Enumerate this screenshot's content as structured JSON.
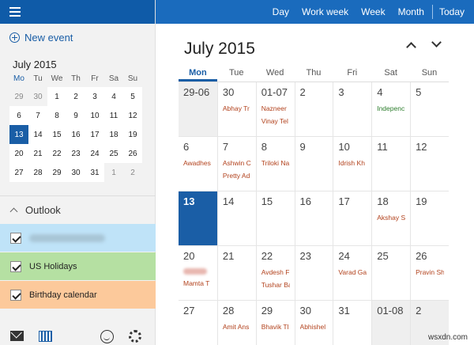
{
  "colors": {
    "accent": "#1a5ea6",
    "topbar": "#1a6bbd",
    "event_text": "#b2421d",
    "holiday_text": "#2c7d2c"
  },
  "sidebar": {
    "new_event": "New event",
    "mini_calendar": {
      "title": "July 2015",
      "days_of_week": [
        "Mo",
        "Tu",
        "We",
        "Th",
        "Fr",
        "Sa",
        "Su"
      ],
      "days": [
        {
          "d": "29",
          "out": true
        },
        {
          "d": "30",
          "out": true
        },
        {
          "d": "1"
        },
        {
          "d": "2"
        },
        {
          "d": "3"
        },
        {
          "d": "4"
        },
        {
          "d": "5"
        },
        {
          "d": "6"
        },
        {
          "d": "7"
        },
        {
          "d": "8"
        },
        {
          "d": "9"
        },
        {
          "d": "10"
        },
        {
          "d": "11"
        },
        {
          "d": "12"
        },
        {
          "d": "13",
          "sel": true
        },
        {
          "d": "14"
        },
        {
          "d": "15"
        },
        {
          "d": "16"
        },
        {
          "d": "17"
        },
        {
          "d": "18"
        },
        {
          "d": "19"
        },
        {
          "d": "20"
        },
        {
          "d": "21"
        },
        {
          "d": "22"
        },
        {
          "d": "23"
        },
        {
          "d": "24"
        },
        {
          "d": "25"
        },
        {
          "d": "26"
        },
        {
          "d": "27"
        },
        {
          "d": "28"
        },
        {
          "d": "29"
        },
        {
          "d": "30"
        },
        {
          "d": "31"
        },
        {
          "d": "1",
          "out": true
        },
        {
          "d": "2",
          "out": true
        }
      ]
    },
    "section_title": "Outlook",
    "calendars": [
      {
        "label": "",
        "checked": true,
        "color": "#bfe3f8"
      },
      {
        "label": "US Holidays",
        "checked": true,
        "color": "#b5e0a2"
      },
      {
        "label": "Birthday calendar",
        "checked": true,
        "color": "#fcc99b"
      }
    ],
    "footer_icons": [
      "mail-icon",
      "calendar-icon",
      "feedback-smiley-icon",
      "settings-gear-icon"
    ]
  },
  "toolbar": {
    "views": [
      "Day",
      "Work week",
      "Week",
      "Month"
    ],
    "today": "Today"
  },
  "main": {
    "month_title": "July 2015",
    "days_of_week": [
      "Mon",
      "Tue",
      "Wed",
      "Thu",
      "Fri",
      "Sat",
      "Sun"
    ],
    "active_dow": "Mon",
    "cells": [
      {
        "d": "29-06",
        "out": true,
        "events": []
      },
      {
        "d": "30",
        "events": [
          {
            "t": "Abhay Tr"
          }
        ]
      },
      {
        "d": "01-07",
        "events": [
          {
            "t": "Nazneer"
          },
          {
            "t": "Vinay Tel"
          }
        ]
      },
      {
        "d": "2",
        "events": []
      },
      {
        "d": "3",
        "events": []
      },
      {
        "d": "4",
        "events": [
          {
            "t": "Indepenc",
            "c": "green"
          }
        ]
      },
      {
        "d": "5",
        "events": []
      },
      {
        "d": "6",
        "events": [
          {
            "t": "Awadhes"
          }
        ]
      },
      {
        "d": "7",
        "events": [
          {
            "t": "Ashwin C"
          },
          {
            "t": "Pretty Ad"
          }
        ]
      },
      {
        "d": "8",
        "events": [
          {
            "t": "Triloki Na"
          }
        ]
      },
      {
        "d": "9",
        "events": []
      },
      {
        "d": "10",
        "events": [
          {
            "t": "Idrish Kh"
          }
        ]
      },
      {
        "d": "11",
        "events": []
      },
      {
        "d": "12",
        "events": []
      },
      {
        "d": "13",
        "today": true,
        "events": []
      },
      {
        "d": "14",
        "events": []
      },
      {
        "d": "15",
        "events": []
      },
      {
        "d": "16",
        "events": []
      },
      {
        "d": "17",
        "events": []
      },
      {
        "d": "18",
        "events": [
          {
            "t": "Akshay S"
          }
        ]
      },
      {
        "d": "19",
        "events": []
      },
      {
        "d": "20",
        "events": [
          {
            "t": "",
            "blur": true
          },
          {
            "t": "Mamta T"
          }
        ]
      },
      {
        "d": "21",
        "events": []
      },
      {
        "d": "22",
        "events": [
          {
            "t": "Avdesh F"
          },
          {
            "t": "Tushar Ba"
          }
        ]
      },
      {
        "d": "23",
        "events": []
      },
      {
        "d": "24",
        "events": [
          {
            "t": "Varad Ga"
          }
        ]
      },
      {
        "d": "25",
        "events": []
      },
      {
        "d": "26",
        "events": [
          {
            "t": "Pravin Sh"
          }
        ]
      },
      {
        "d": "27",
        "events": []
      },
      {
        "d": "28",
        "events": [
          {
            "t": "Amit Ans"
          }
        ]
      },
      {
        "d": "29",
        "events": [
          {
            "t": "Bhavik Tl"
          }
        ]
      },
      {
        "d": "30",
        "events": [
          {
            "t": "Abhishel"
          }
        ]
      },
      {
        "d": "31",
        "events": []
      },
      {
        "d": "01-08",
        "out": true,
        "events": []
      },
      {
        "d": "2",
        "out": true,
        "events": []
      }
    ]
  },
  "watermark": "wsxdn.com"
}
